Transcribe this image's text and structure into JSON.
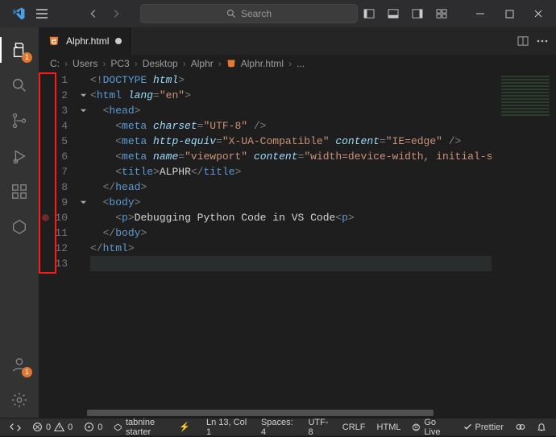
{
  "titlebar": {
    "search_placeholder": "Search"
  },
  "activity": {
    "explorer_badge": "1",
    "accounts_badge": "1"
  },
  "tab": {
    "filename": "Alphr.html"
  },
  "breadcrumb": {
    "parts": [
      "C:",
      "Users",
      "PC3",
      "Desktop",
      "Alphr"
    ],
    "file": "Alphr.html",
    "trailing": "..."
  },
  "code": {
    "lines": [
      {
        "n": 1,
        "fold": "",
        "tokens": [
          [
            "sk-punc",
            "<!"
          ],
          [
            "sk-doc",
            "DOCTYPE "
          ],
          [
            "sk-attr",
            "html"
          ],
          [
            "sk-punc",
            ">"
          ]
        ]
      },
      {
        "n": 2,
        "fold": "v",
        "tokens": [
          [
            "sk-punc",
            "<"
          ],
          [
            "sk-tag",
            "html "
          ],
          [
            "sk-attr",
            "lang"
          ],
          [
            "sk-punc",
            "="
          ],
          [
            "sk-str",
            "\"en\""
          ],
          [
            "sk-punc",
            ">"
          ]
        ]
      },
      {
        "n": 3,
        "fold": "v",
        "indent": 1,
        "tokens": [
          [
            "sk-punc",
            "<"
          ],
          [
            "sk-tag",
            "head"
          ],
          [
            "sk-punc",
            ">"
          ]
        ]
      },
      {
        "n": 4,
        "fold": "",
        "indent": 2,
        "tokens": [
          [
            "sk-punc",
            "<"
          ],
          [
            "sk-tag",
            "meta "
          ],
          [
            "sk-attr",
            "charset"
          ],
          [
            "sk-punc",
            "="
          ],
          [
            "sk-str",
            "\"UTF-8\""
          ],
          [
            "sk-punc",
            " />"
          ]
        ]
      },
      {
        "n": 5,
        "fold": "",
        "indent": 2,
        "tokens": [
          [
            "sk-punc",
            "<"
          ],
          [
            "sk-tag",
            "meta "
          ],
          [
            "sk-attr",
            "http-equiv"
          ],
          [
            "sk-punc",
            "="
          ],
          [
            "sk-str",
            "\"X-UA-Compatible\""
          ],
          [
            "sk-txt",
            " "
          ],
          [
            "sk-attr",
            "content"
          ],
          [
            "sk-punc",
            "="
          ],
          [
            "sk-str",
            "\"IE=edge\""
          ],
          [
            "sk-punc",
            " />"
          ]
        ]
      },
      {
        "n": 6,
        "fold": "",
        "indent": 2,
        "tokens": [
          [
            "sk-punc",
            "<"
          ],
          [
            "sk-tag",
            "meta "
          ],
          [
            "sk-attr",
            "name"
          ],
          [
            "sk-punc",
            "="
          ],
          [
            "sk-str",
            "\"viewport\""
          ],
          [
            "sk-txt",
            " "
          ],
          [
            "sk-attr",
            "content"
          ],
          [
            "sk-punc",
            "="
          ],
          [
            "sk-str",
            "\"width=device-width, initial-sca"
          ]
        ]
      },
      {
        "n": 7,
        "fold": "",
        "indent": 2,
        "tokens": [
          [
            "sk-punc",
            "<"
          ],
          [
            "sk-tag",
            "title"
          ],
          [
            "sk-punc",
            ">"
          ],
          [
            "sk-txt",
            "ALPHR"
          ],
          [
            "sk-punc",
            "</"
          ],
          [
            "sk-tag",
            "title"
          ],
          [
            "sk-punc",
            ">"
          ]
        ]
      },
      {
        "n": 8,
        "fold": "",
        "indent": 1,
        "tokens": [
          [
            "sk-punc",
            "</"
          ],
          [
            "sk-tag",
            "head"
          ],
          [
            "sk-punc",
            ">"
          ]
        ]
      },
      {
        "n": 9,
        "fold": "v",
        "indent": 1,
        "tokens": [
          [
            "sk-punc",
            "<"
          ],
          [
            "sk-tag",
            "body"
          ],
          [
            "sk-punc",
            ">"
          ]
        ]
      },
      {
        "n": 10,
        "fold": "",
        "indent": 2,
        "bp": true,
        "tokens": [
          [
            "sk-punc",
            "<"
          ],
          [
            "sk-tag",
            "p"
          ],
          [
            "sk-punc",
            ">"
          ],
          [
            "sk-txt",
            "Debugging Python Code in VS Code"
          ],
          [
            "sk-punc",
            "<"
          ],
          [
            "sk-tag",
            "p"
          ],
          [
            "sk-punc",
            ">"
          ]
        ]
      },
      {
        "n": 11,
        "fold": "",
        "indent": 1,
        "tokens": [
          [
            "sk-punc",
            "</"
          ],
          [
            "sk-tag",
            "body"
          ],
          [
            "sk-punc",
            ">"
          ]
        ]
      },
      {
        "n": 12,
        "fold": "",
        "tokens": [
          [
            "sk-punc",
            "</"
          ],
          [
            "sk-tag",
            "html"
          ],
          [
            "sk-punc",
            ">"
          ]
        ]
      },
      {
        "n": 13,
        "fold": "",
        "current": true,
        "tokens": []
      }
    ]
  },
  "status": {
    "remote": "",
    "errors": "0",
    "warnings": "0",
    "ports": "0",
    "tabnine": "tabnine starter",
    "bolt": "⚡",
    "ln_col": "Ln 13, Col 1",
    "spaces": "Spaces: 4",
    "encoding": "UTF-8",
    "eol": "CRLF",
    "lang": "HTML",
    "golive": "Go Live",
    "prettier": "Prettier",
    "feedback": "",
    "bell": ""
  }
}
